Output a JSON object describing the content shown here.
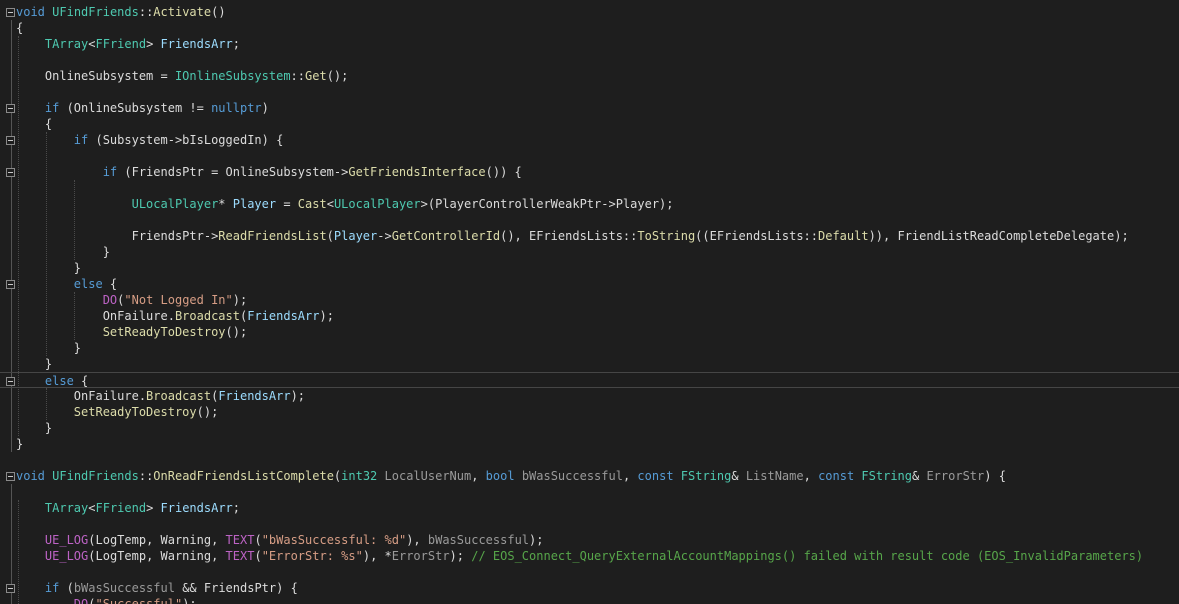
{
  "lines": [
    {
      "fold": true,
      "current": false,
      "tokens": [
        {
          "t": "void",
          "k": "kw"
        },
        {
          "t": " "
        },
        {
          "t": "UFindFriends",
          "k": "type"
        },
        {
          "t": "::"
        },
        {
          "t": "Activate",
          "k": "fn"
        },
        {
          "t": "()"
        }
      ]
    },
    {
      "fold": false,
      "current": false,
      "tokens": [
        {
          "t": "{"
        }
      ]
    },
    {
      "fold": false,
      "current": false,
      "tokens": [
        {
          "t": "    "
        },
        {
          "t": "TArray",
          "k": "type"
        },
        {
          "t": "<"
        },
        {
          "t": "FFriend",
          "k": "type"
        },
        {
          "t": "> "
        },
        {
          "t": "FriendsArr",
          "k": "var"
        },
        {
          "t": ";"
        }
      ]
    },
    {
      "fold": false,
      "current": false,
      "tokens": []
    },
    {
      "fold": false,
      "current": false,
      "tokens": [
        {
          "t": "    OnlineSubsystem = "
        },
        {
          "t": "IOnlineSubsystem",
          "k": "type"
        },
        {
          "t": "::"
        },
        {
          "t": "Get",
          "k": "fn"
        },
        {
          "t": "();"
        }
      ]
    },
    {
      "fold": false,
      "current": false,
      "tokens": []
    },
    {
      "fold": true,
      "current": false,
      "tokens": [
        {
          "t": "    "
        },
        {
          "t": "if",
          "k": "kw"
        },
        {
          "t": " (OnlineSubsystem != "
        },
        {
          "t": "nullptr",
          "k": "kw"
        },
        {
          "t": ")"
        }
      ]
    },
    {
      "fold": false,
      "current": false,
      "tokens": [
        {
          "t": "    {"
        }
      ]
    },
    {
      "fold": true,
      "current": false,
      "tokens": [
        {
          "t": "        "
        },
        {
          "t": "if",
          "k": "kw"
        },
        {
          "t": " (Subsystem->bIsLoggedIn) {"
        }
      ]
    },
    {
      "fold": false,
      "current": false,
      "tokens": []
    },
    {
      "fold": true,
      "current": false,
      "tokens": [
        {
          "t": "            "
        },
        {
          "t": "if",
          "k": "kw"
        },
        {
          "t": " (FriendsPtr = OnlineSubsystem->"
        },
        {
          "t": "GetFriendsInterface",
          "k": "fn"
        },
        {
          "t": "()) {"
        }
      ]
    },
    {
      "fold": false,
      "current": false,
      "tokens": []
    },
    {
      "fold": false,
      "current": false,
      "tokens": [
        {
          "t": "                "
        },
        {
          "t": "ULocalPlayer",
          "k": "type"
        },
        {
          "t": "* "
        },
        {
          "t": "Player",
          "k": "var"
        },
        {
          "t": " = "
        },
        {
          "t": "Cast",
          "k": "fn"
        },
        {
          "t": "<"
        },
        {
          "t": "ULocalPlayer",
          "k": "type"
        },
        {
          "t": ">(PlayerControllerWeakPtr->Player);"
        }
      ]
    },
    {
      "fold": false,
      "current": false,
      "tokens": []
    },
    {
      "fold": false,
      "current": false,
      "tokens": [
        {
          "t": "                FriendsPtr->"
        },
        {
          "t": "ReadFriendsList",
          "k": "fn"
        },
        {
          "t": "("
        },
        {
          "t": "Player",
          "k": "var"
        },
        {
          "t": "->"
        },
        {
          "t": "GetControllerId",
          "k": "fn"
        },
        {
          "t": "(), EFriendsLists::"
        },
        {
          "t": "ToString",
          "k": "fn"
        },
        {
          "t": "((EFriendsLists::"
        },
        {
          "t": "Default",
          "k": "fn"
        },
        {
          "t": ")), FriendListReadCompleteDelegate);"
        }
      ]
    },
    {
      "fold": false,
      "current": false,
      "tokens": [
        {
          "t": "            }"
        }
      ]
    },
    {
      "fold": false,
      "current": false,
      "tokens": [
        {
          "t": "        }"
        }
      ]
    },
    {
      "fold": true,
      "current": false,
      "tokens": [
        {
          "t": "        "
        },
        {
          "t": "else",
          "k": "kw"
        },
        {
          "t": " {"
        }
      ]
    },
    {
      "fold": false,
      "current": false,
      "tokens": [
        {
          "t": "            "
        },
        {
          "t": "DO",
          "k": "mac"
        },
        {
          "t": "("
        },
        {
          "t": "\"Not Logged In\"",
          "k": "str"
        },
        {
          "t": ");"
        }
      ]
    },
    {
      "fold": false,
      "current": false,
      "tokens": [
        {
          "t": "            OnFailure."
        },
        {
          "t": "Broadcast",
          "k": "fn"
        },
        {
          "t": "("
        },
        {
          "t": "FriendsArr",
          "k": "var"
        },
        {
          "t": ");"
        }
      ]
    },
    {
      "fold": false,
      "current": false,
      "tokens": [
        {
          "t": "            "
        },
        {
          "t": "SetReadyToDestroy",
          "k": "fn"
        },
        {
          "t": "();"
        }
      ]
    },
    {
      "fold": false,
      "current": false,
      "tokens": [
        {
          "t": "        }"
        }
      ]
    },
    {
      "fold": false,
      "current": false,
      "tokens": [
        {
          "t": "    }"
        }
      ]
    },
    {
      "fold": true,
      "current": true,
      "tokens": [
        {
          "t": "    "
        },
        {
          "t": "else",
          "k": "kw"
        },
        {
          "t": " {"
        }
      ]
    },
    {
      "fold": false,
      "current": false,
      "tokens": [
        {
          "t": "        OnFailure."
        },
        {
          "t": "Broadcast",
          "k": "fn"
        },
        {
          "t": "("
        },
        {
          "t": "FriendsArr",
          "k": "var"
        },
        {
          "t": ");"
        }
      ]
    },
    {
      "fold": false,
      "current": false,
      "tokens": [
        {
          "t": "        "
        },
        {
          "t": "SetReadyToDestroy",
          "k": "fn"
        },
        {
          "t": "();"
        }
      ]
    },
    {
      "fold": false,
      "current": false,
      "tokens": [
        {
          "t": "    }"
        }
      ]
    },
    {
      "fold": false,
      "current": false,
      "tokens": [
        {
          "t": "}"
        }
      ]
    },
    {
      "fold": false,
      "current": false,
      "tokens": []
    },
    {
      "fold": true,
      "current": false,
      "tokens": [
        {
          "t": "void",
          "k": "kw"
        },
        {
          "t": " "
        },
        {
          "t": "UFindFriends",
          "k": "type"
        },
        {
          "t": "::"
        },
        {
          "t": "OnReadFriendsListComplete",
          "k": "fn"
        },
        {
          "t": "("
        },
        {
          "t": "int32",
          "k": "type"
        },
        {
          "t": " "
        },
        {
          "t": "LocalUserNum",
          "k": "param"
        },
        {
          "t": ", "
        },
        {
          "t": "bool",
          "k": "kw"
        },
        {
          "t": " "
        },
        {
          "t": "bWasSuccessful",
          "k": "param"
        },
        {
          "t": ", "
        },
        {
          "t": "const",
          "k": "kw"
        },
        {
          "t": " "
        },
        {
          "t": "FString",
          "k": "type"
        },
        {
          "t": "& "
        },
        {
          "t": "ListName",
          "k": "param"
        },
        {
          "t": ", "
        },
        {
          "t": "const",
          "k": "kw"
        },
        {
          "t": " "
        },
        {
          "t": "FString",
          "k": "type"
        },
        {
          "t": "& "
        },
        {
          "t": "ErrorStr",
          "k": "param"
        },
        {
          "t": ") {"
        }
      ]
    },
    {
      "fold": false,
      "current": false,
      "tokens": []
    },
    {
      "fold": false,
      "current": false,
      "tokens": [
        {
          "t": "    "
        },
        {
          "t": "TArray",
          "k": "type"
        },
        {
          "t": "<"
        },
        {
          "t": "FFriend",
          "k": "type"
        },
        {
          "t": "> "
        },
        {
          "t": "FriendsArr",
          "k": "var"
        },
        {
          "t": ";"
        }
      ]
    },
    {
      "fold": false,
      "current": false,
      "tokens": []
    },
    {
      "fold": false,
      "current": false,
      "tokens": [
        {
          "t": "    "
        },
        {
          "t": "UE_LOG",
          "k": "mac"
        },
        {
          "t": "(LogTemp, Warning, "
        },
        {
          "t": "TEXT",
          "k": "mac"
        },
        {
          "t": "("
        },
        {
          "t": "\"bWasSuccessful: %d\"",
          "k": "str"
        },
        {
          "t": "), "
        },
        {
          "t": "bWasSuccessful",
          "k": "param"
        },
        {
          "t": ");"
        }
      ]
    },
    {
      "fold": false,
      "current": false,
      "tokens": [
        {
          "t": "    "
        },
        {
          "t": "UE_LOG",
          "k": "mac"
        },
        {
          "t": "(LogTemp, Warning, "
        },
        {
          "t": "TEXT",
          "k": "mac"
        },
        {
          "t": "("
        },
        {
          "t": "\"ErrorStr: %s\"",
          "k": "str"
        },
        {
          "t": "), *"
        },
        {
          "t": "ErrorStr",
          "k": "param"
        },
        {
          "t": "); "
        },
        {
          "t": "// EOS_Connect_QueryExternalAccountMappings() failed with result code (EOS_InvalidParameters)",
          "k": "com"
        }
      ]
    },
    {
      "fold": false,
      "current": false,
      "tokens": []
    },
    {
      "fold": true,
      "current": false,
      "tokens": [
        {
          "t": "    "
        },
        {
          "t": "if",
          "k": "kw"
        },
        {
          "t": " ("
        },
        {
          "t": "bWasSuccessful",
          "k": "param"
        },
        {
          "t": " && FriendsPtr) {"
        }
      ]
    },
    {
      "fold": false,
      "current": false,
      "tokens": [
        {
          "t": "        "
        },
        {
          "t": "DO",
          "k": "mac"
        },
        {
          "t": "("
        },
        {
          "t": "\"Successful\"",
          "k": "str"
        },
        {
          "t": ");"
        }
      ]
    }
  ]
}
